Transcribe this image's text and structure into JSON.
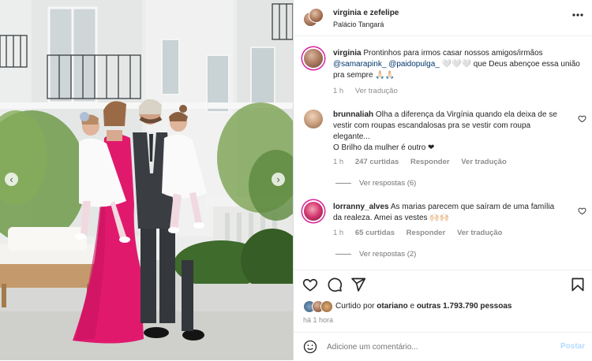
{
  "post_header": {
    "username": "virginia e zefelipe",
    "location": "Palácio Tangará",
    "more_icon": "more-horizontal-icon"
  },
  "caption": {
    "username": "virginia",
    "line1": "Prontinhos para irmos casar nossos amigos/irmãos",
    "mention1": "@samarapink_",
    "mention2": "@paidopulga_",
    "line2_rest": "🤍🤍🤍 que Deus abençoe essa união",
    "line3": "pra sempre 🙏🏻🙏🏻",
    "time": "1 h",
    "translate": "Ver tradução"
  },
  "comments": [
    {
      "username": "brunnaliah",
      "line1": "Olha a diferença da Virgínia quando ela deixa de se",
      "line2": "vestir com roupas escandalosas pra se vestir com roupa",
      "line3": "elegante...",
      "line4": "O Brilho da mulher é outro ❤",
      "time": "1 h",
      "likes": "247 curtidas",
      "reply": "Responder",
      "translate": "Ver tradução",
      "view_replies": "Ver respostas (6)"
    },
    {
      "username": "lorranny_alves",
      "line1": "As marias parecem que saíram de uma família",
      "line2": "da realeza. Amei as vestes 🙌🏻🙌🏻",
      "time": "1 h",
      "likes": "65 curtidas",
      "reply": "Responder",
      "translate": "Ver tradução",
      "view_replies": "Ver respostas (2)"
    }
  ],
  "likes_line": {
    "prefix": "Curtido por",
    "user": "otariano",
    "middle": "e",
    "others": "outras 1.793.790 pessoas"
  },
  "timestamp": "há 1 hora",
  "composer": {
    "placeholder": "Adicione um comentário...",
    "post_label": "Postar",
    "emoji_icon": "emoji-icon"
  },
  "colors": {
    "dress_pink": "#e0196d",
    "suit": "#3a3d42",
    "link": "#00376b",
    "post_button": "#b3dbff",
    "story_ring": "#d6249f"
  }
}
